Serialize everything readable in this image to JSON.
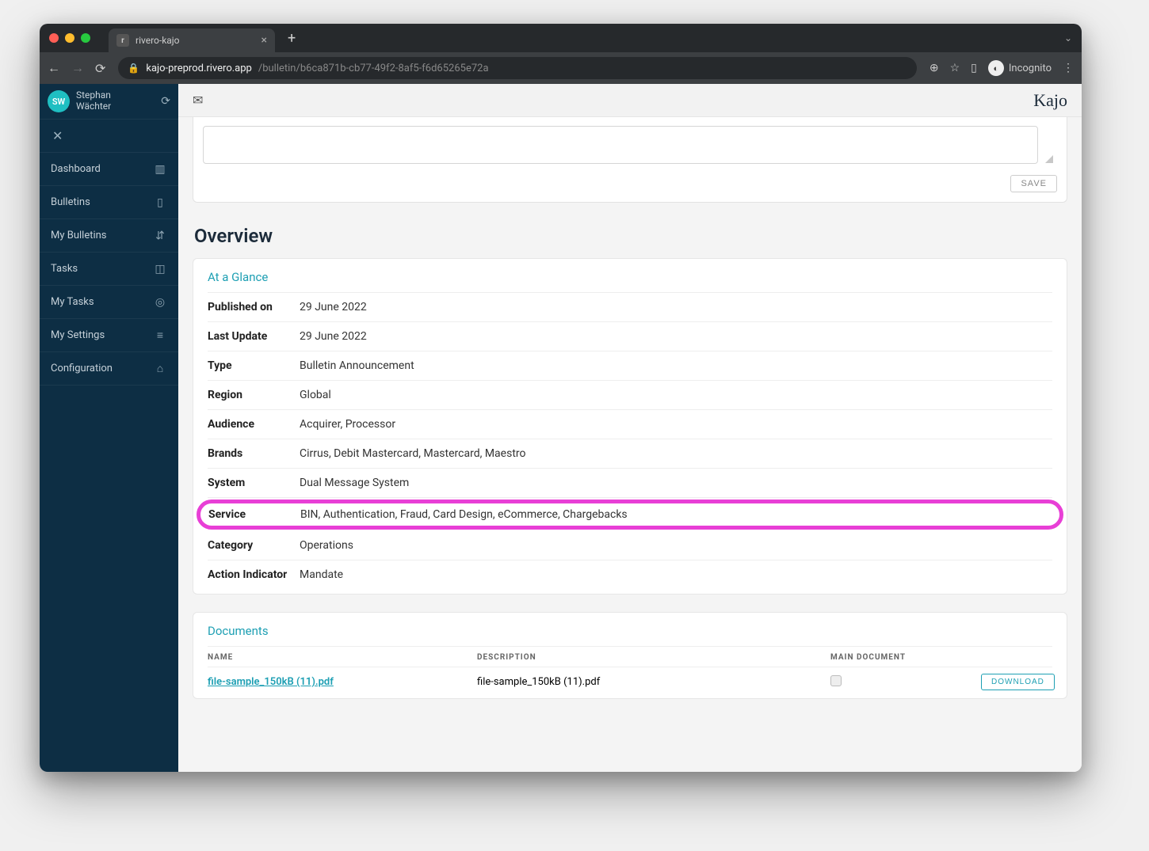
{
  "browser": {
    "tab_title": "rivero-kajo",
    "url_host": "kajo-preprod.rivero.app",
    "url_path": "/bulletin/b6ca871b-cb77-49f2-8af5-f6d65265e72a",
    "incognito_label": "Incognito"
  },
  "user": {
    "initials": "SW",
    "name_line1": "Stephan",
    "name_line2": "Wächter"
  },
  "sidebar": {
    "items": [
      {
        "label": "Dashboard",
        "icon": "▥"
      },
      {
        "label": "Bulletins",
        "icon": "▯"
      },
      {
        "label": "My Bulletins",
        "icon": "⇵"
      },
      {
        "label": "Tasks",
        "icon": "◫"
      },
      {
        "label": "My Tasks",
        "icon": "◎"
      },
      {
        "label": "My Settings",
        "icon": "≡"
      },
      {
        "label": "Configuration",
        "icon": "⌂"
      }
    ]
  },
  "header": {
    "brand": "Kajo",
    "save_label": "SAVE"
  },
  "overview": {
    "title": "Overview",
    "at_a_glance_title": "At a Glance",
    "rows": [
      {
        "key": "Published on",
        "val": "29 June 2022"
      },
      {
        "key": "Last Update",
        "val": "29 June 2022"
      },
      {
        "key": "Type",
        "val": "Bulletin Announcement"
      },
      {
        "key": "Region",
        "val": "Global"
      },
      {
        "key": "Audience",
        "val": "Acquirer, Processor"
      },
      {
        "key": "Brands",
        "val": "Cirrus, Debit Mastercard, Mastercard, Maestro"
      },
      {
        "key": "System",
        "val": "Dual Message System"
      },
      {
        "key": "Service",
        "val": "BIN, Authentication, Fraud, Card Design, eCommerce, Chargebacks"
      },
      {
        "key": "Category",
        "val": "Operations"
      },
      {
        "key": "Action Indicator",
        "val": "Mandate"
      }
    ],
    "highlight_index": 7
  },
  "documents": {
    "title": "Documents",
    "headers": {
      "name": "NAME",
      "desc": "DESCRIPTION",
      "main": "MAIN DOCUMENT"
    },
    "download_label": "DOWNLOAD",
    "rows": [
      {
        "name": "file-sample_150kB (11).pdf",
        "desc": "file-sample_150kB (11).pdf",
        "main": true
      }
    ]
  }
}
